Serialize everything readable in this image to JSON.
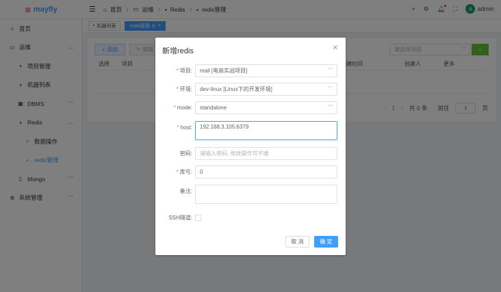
{
  "header": {
    "logo": "mayfly",
    "breadcrumb": [
      "首页",
      "运维",
      "Redis",
      "redis管理"
    ],
    "user": "admin",
    "avatar_letter": "A"
  },
  "sidebar": {
    "items": [
      {
        "label": "首页",
        "icon": "home-icon"
      },
      {
        "label": "运维",
        "icon": "monitor-icon"
      },
      {
        "label": "项目管理",
        "icon": "grid-icon"
      },
      {
        "label": "机器列表",
        "icon": "grid-icon"
      },
      {
        "label": "DBMS",
        "icon": "table-icon"
      },
      {
        "label": "Redis",
        "icon": "grid-icon"
      },
      {
        "label": "数据操作",
        "icon": "search-icon"
      },
      {
        "label": "redis管理",
        "icon": "grid-icon"
      },
      {
        "label": "Mongo",
        "icon": "document-icon"
      },
      {
        "label": "系统管理",
        "icon": "gear-icon"
      }
    ]
  },
  "tabs": [
    {
      "label": "机器列表"
    },
    {
      "label": "redis管理"
    }
  ],
  "toolbar": {
    "add": "添加",
    "edit": "编辑",
    "project_placeholder": "请选择项目"
  },
  "table": {
    "headers": [
      "选择",
      "项目",
      "创建时间",
      "创建人",
      "更多"
    ]
  },
  "pager": {
    "page": "1",
    "total": "共 0 条",
    "goto": "前往",
    "goto_value": "1",
    "page_unit": "页"
  },
  "dialog": {
    "title": "新增redis",
    "fields": {
      "project": {
        "label": "项目:",
        "value": "mall [电商实战项目]"
      },
      "env": {
        "label": "环境:",
        "value": "dev-linux [Linux下的开发环境]"
      },
      "mode": {
        "label": "mode:",
        "value": "standalone"
      },
      "host": {
        "label": "host:",
        "value": "192.168.3.105:6379"
      },
      "password": {
        "label": "密码:",
        "placeholder": "请输入密码, 修改操作可不填"
      },
      "db": {
        "label": "库号:",
        "value": "0"
      },
      "remark": {
        "label": "备注:",
        "value": ""
      },
      "ssh": {
        "label": "SSH隧道:"
      }
    },
    "cancel": "取 消",
    "confirm": "确 定"
  }
}
